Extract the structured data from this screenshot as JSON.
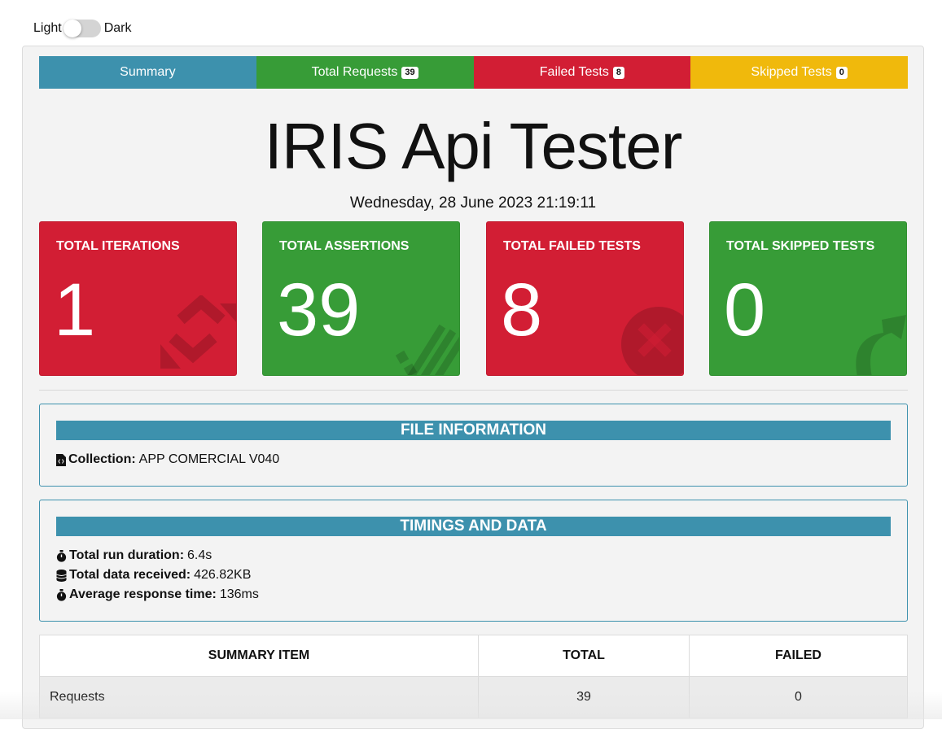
{
  "theme": {
    "light_label": "Light",
    "dark_label": "Dark"
  },
  "tabs": [
    {
      "label": "Summary",
      "badge": null
    },
    {
      "label": "Total Requests",
      "badge": "39"
    },
    {
      "label": "Failed Tests",
      "badge": "8"
    },
    {
      "label": "Skipped Tests",
      "badge": "0"
    }
  ],
  "header": {
    "title": "IRIS Api Tester",
    "date": "Wednesday, 28 June 2023 21:19:11"
  },
  "cards": [
    {
      "label": "TOTAL ITERATIONS",
      "value": "1",
      "icon": "sync-icon"
    },
    {
      "label": "TOTAL ASSERTIONS",
      "value": "39",
      "icon": "tasks-icon"
    },
    {
      "label": "TOTAL FAILED TESTS",
      "value": "8",
      "icon": "times-circle-icon"
    },
    {
      "label": "TOTAL SKIPPED TESTS",
      "value": "0",
      "icon": "share-icon"
    }
  ],
  "file_info": {
    "heading": "FILE INFORMATION",
    "collection_label": "Collection:",
    "collection_value": "APP COMERCIAL V040"
  },
  "timings": {
    "heading": "TIMINGS AND DATA",
    "rows": [
      {
        "label": "Total run duration:",
        "value": "6.4s"
      },
      {
        "label": "Total data received:",
        "value": "426.82KB"
      },
      {
        "label": "Average response time:",
        "value": "136ms"
      }
    ]
  },
  "summary_table": {
    "headers": [
      "SUMMARY ITEM",
      "TOTAL",
      "FAILED"
    ],
    "rows": [
      [
        "Requests",
        "39",
        "0"
      ]
    ]
  },
  "colors": {
    "blue": "#3d91ad",
    "green": "#379c37",
    "red": "#d21e34",
    "yellow": "#f0b90c"
  }
}
